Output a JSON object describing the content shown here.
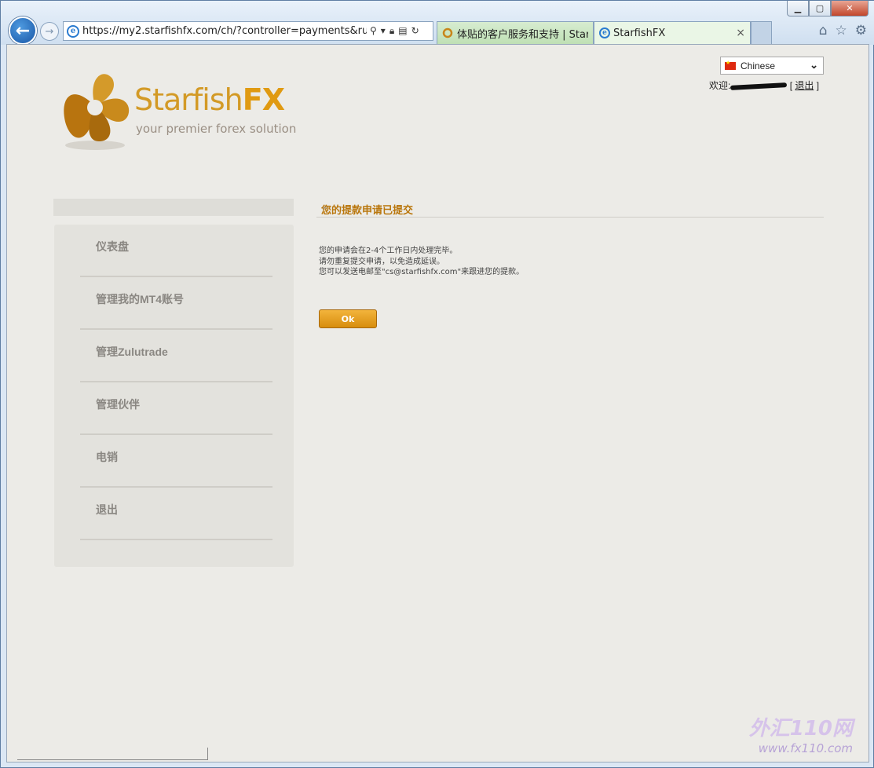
{
  "browser": {
    "url": "https://my2.starfishfx.com/ch/?controller=payments&run=add",
    "tabs": [
      {
        "label": "体贴的客户服务和支持 | Starfi..."
      },
      {
        "label": "StarfishFX"
      }
    ],
    "tab_close": "×"
  },
  "header": {
    "brand_prefix": "Starfish",
    "brand_suffix": "FX",
    "tagline": "your premier forex solution",
    "language": "Chinese",
    "welcome_prefix": "欢迎:",
    "logout_label": "退出",
    "bracket_open": "[",
    "bracket_close": "]"
  },
  "sidebar": {
    "items": [
      {
        "label": "仪表盘"
      },
      {
        "label": "管理我的MT4账号"
      },
      {
        "label": "管理Zulutrade"
      },
      {
        "label": "管理伙伴"
      },
      {
        "label": "电销"
      },
      {
        "label": "退出"
      }
    ]
  },
  "main": {
    "title": "您的提款申请已提交",
    "lines": [
      "您的申请会在2-4个工作日内处理完毕。",
      "请勿重复提交申请，以免造成延误。",
      "您可以发送电邮至\"cs@starfishfx.com\"来跟进您的提款。"
    ],
    "ok_label": "Ok"
  },
  "watermark": {
    "line1": "外汇110网",
    "line2": "www.fx110.com"
  }
}
